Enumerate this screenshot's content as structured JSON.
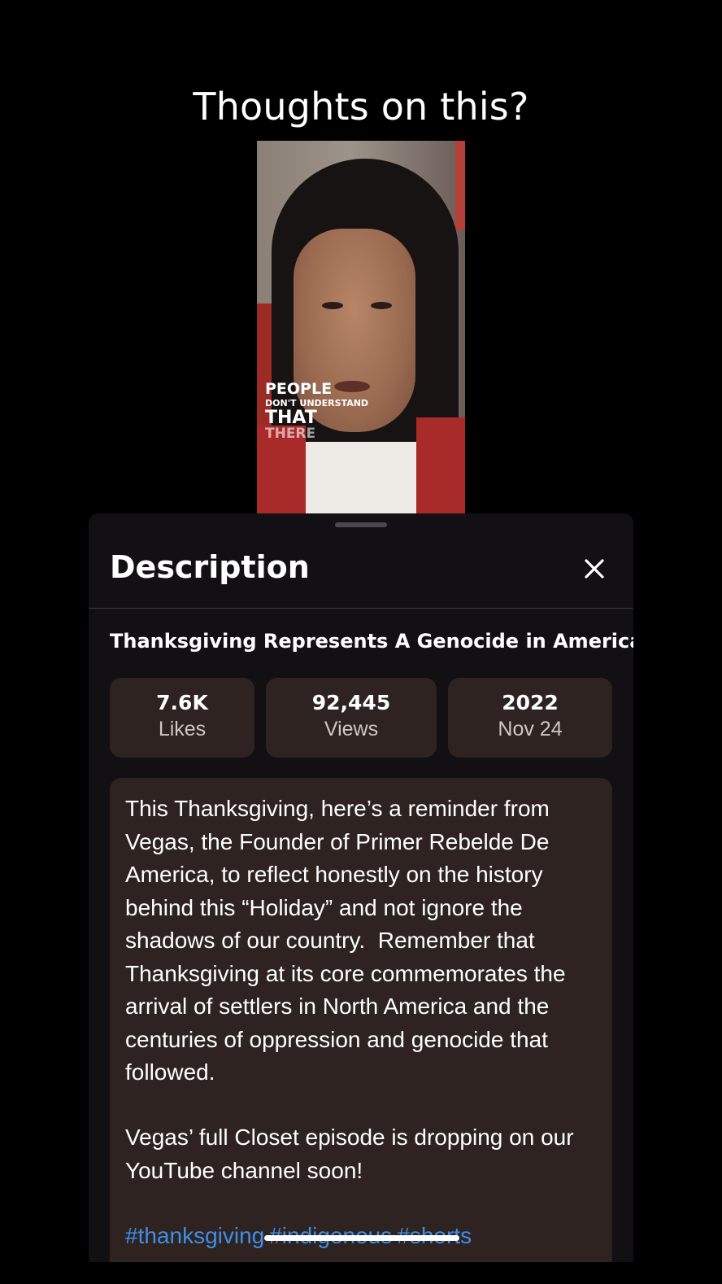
{
  "caption": "Thoughts on this?",
  "video": {
    "overlay_lines": [
      "PEOPLE",
      "DON'T UNDERSTAND",
      "THAT",
      "THERE"
    ]
  },
  "sheet": {
    "title": "Description",
    "close_icon": "close-icon",
    "video_title": "Thanksgiving Represents A Genocide in America",
    "stats": {
      "likes_value": "7.6K",
      "likes_label": "Likes",
      "views_value": "92,445",
      "views_label": "Views",
      "year": "2022",
      "date": "Nov 24"
    },
    "description": {
      "paragraph1": "This Thanksgiving, here’s a reminder from Vegas, the Founder of Primer Rebelde De America, to reflect honestly on the history behind this “Holiday” and not ignore the shadows of our country.  Remember that Thanksgiving at its core commemorates the arrival of settlers in North America and the centuries of oppression and genocide that followed.",
      "paragraph2": "Vegas’ full Closet episode is dropping on our YouTube channel soon!",
      "hashtags": [
        "#thanksgiving",
        "#indigenous",
        "#shorts"
      ]
    }
  },
  "colors": {
    "background": "#000000",
    "sheet": "#121013",
    "card": "#2f2321",
    "hashtag": "#3e8ee8"
  }
}
